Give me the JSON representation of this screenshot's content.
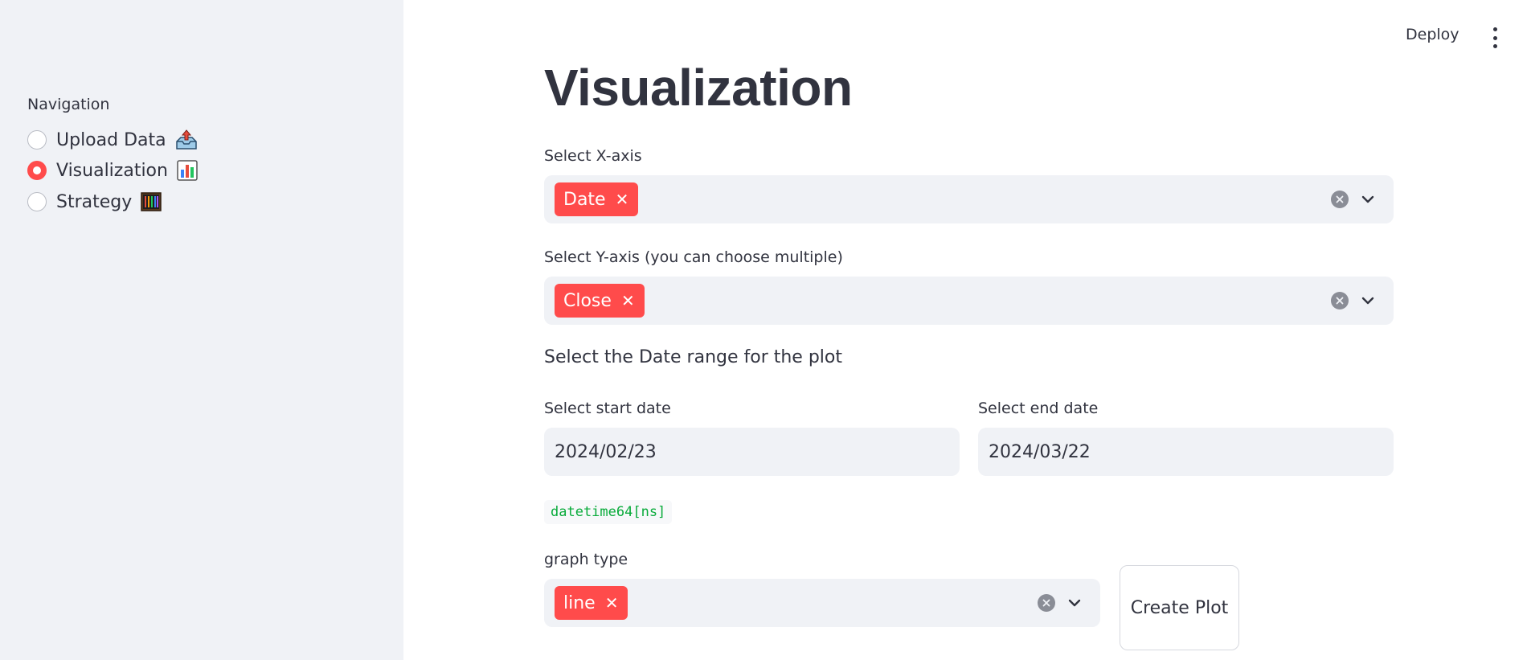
{
  "sidebar": {
    "heading": "Navigation",
    "options": [
      {
        "label": "Upload Data",
        "icon": "inbox-tray-upload-icon",
        "selected": false
      },
      {
        "label": "Visualization",
        "icon": "bar-chart-icon",
        "selected": true
      },
      {
        "label": "Strategy",
        "icon": "abacus-icon",
        "selected": false
      }
    ]
  },
  "header": {
    "deploy_label": "Deploy",
    "menu_icon": "vertical-ellipsis-icon"
  },
  "main": {
    "title": "Visualization",
    "x_axis": {
      "label": "Select X-axis",
      "selected": [
        "Date"
      ]
    },
    "y_axis": {
      "label": "Select Y-axis (you can choose multiple)",
      "selected": [
        "Close"
      ]
    },
    "date_range_caption": "Select the Date range for the plot",
    "start_date": {
      "label": "Select start date",
      "value": "2024/02/23"
    },
    "end_date": {
      "label": "Select end date",
      "value": "2024/03/22"
    },
    "dtype_code": "datetime64[ns]",
    "graph_type": {
      "label": "graph type",
      "selected": [
        "line"
      ]
    },
    "create_plot_label": "Create Plot"
  },
  "colors": {
    "accent": "#ff4b4b",
    "sidebar_bg": "#f0f2f6",
    "text": "#31333f",
    "code_green": "#09ab3b"
  }
}
